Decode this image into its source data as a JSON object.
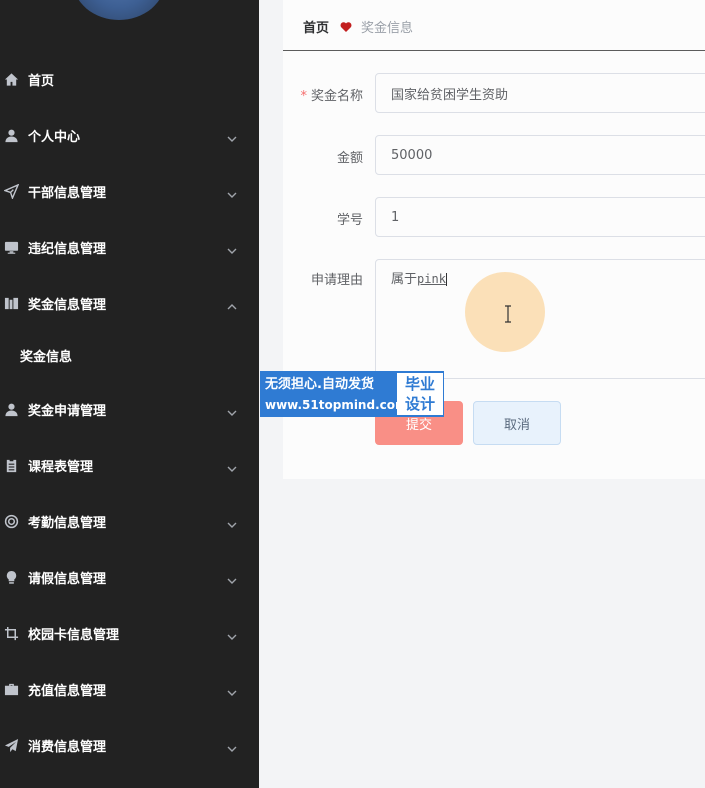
{
  "sidebar": {
    "items": [
      {
        "label": "首页",
        "icon": "home-icon"
      },
      {
        "label": "个人中心",
        "icon": "user-icon"
      },
      {
        "label": "干部信息管理",
        "icon": "send-icon"
      },
      {
        "label": "违纪信息管理",
        "icon": "monitor-icon"
      },
      {
        "label": "奖金信息管理",
        "icon": "books-icon"
      },
      {
        "label": "奖金申请管理",
        "icon": "user-icon"
      },
      {
        "label": "课程表管理",
        "icon": "clipboard-icon"
      },
      {
        "label": "考勤信息管理",
        "icon": "lifebuoy-icon"
      },
      {
        "label": "请假信息管理",
        "icon": "bulb-icon"
      },
      {
        "label": "校园卡信息管理",
        "icon": "crop-icon"
      },
      {
        "label": "充值信息管理",
        "icon": "briefcase-icon"
      },
      {
        "label": "消费信息管理",
        "icon": "paper-plane-icon"
      }
    ],
    "submenu": {
      "label": "奖金信息"
    }
  },
  "breadcrumb": {
    "home": "首页",
    "current": "奖金信息"
  },
  "form": {
    "name_label": "奖金名称",
    "name_required_mark": "*",
    "name_value": "国家给贫困学生资助",
    "amount_label": "金额",
    "amount_value": "50000",
    "student_id_label": "学号",
    "student_id_value": "1",
    "reason_label": "申请理由",
    "reason_prefix": "属于",
    "reason_typed": "pink",
    "submit_label": "提交",
    "cancel_label": "取消"
  },
  "watermark": {
    "line1": "无须担心.自动发货",
    "line2": "www.51topmind.com",
    "badge_line1": "毕业",
    "badge_line2": "设计"
  },
  "colors": {
    "sidebar_bg": "#222222",
    "submit_bg": "#f98f86",
    "cancel_bg": "#e8f2fc",
    "heart": "#c21f1f",
    "required": "#f56c6c",
    "watermark_bg": "#2f7bd3"
  }
}
